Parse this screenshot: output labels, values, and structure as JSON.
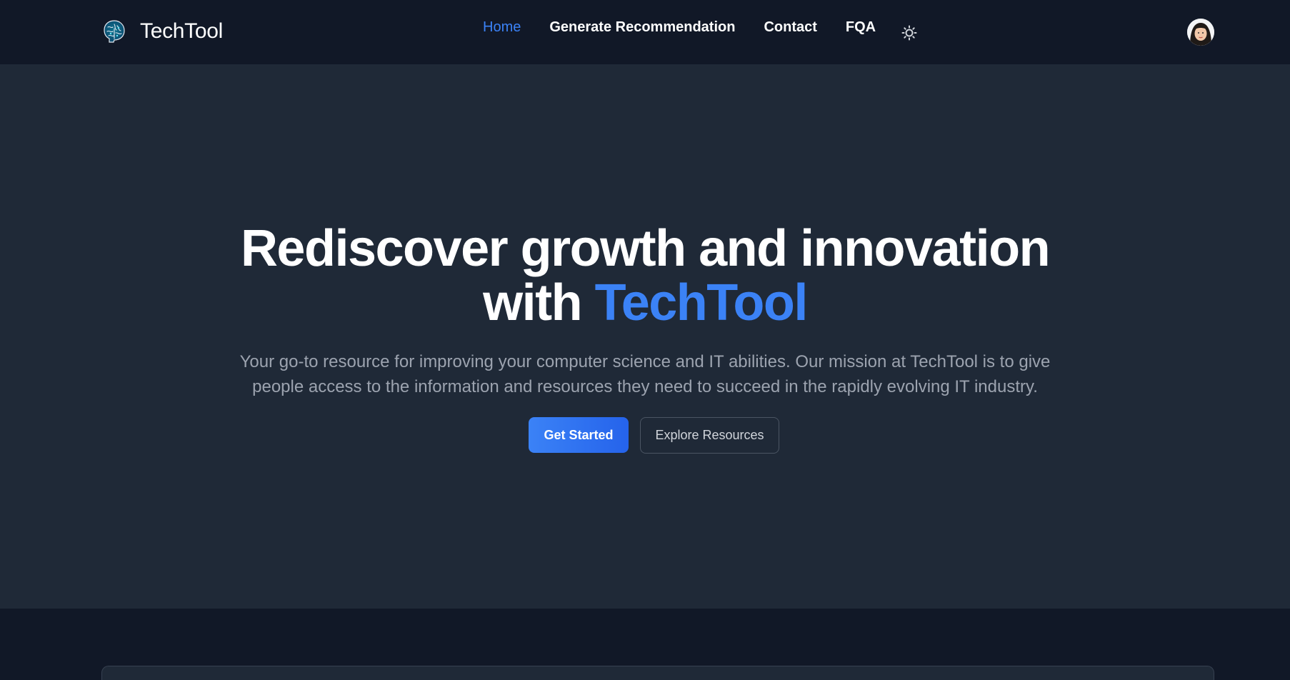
{
  "brand": {
    "name": "TechTool",
    "logo_icon": "brain-icon"
  },
  "nav": {
    "links": [
      {
        "label": "Home",
        "active": true
      },
      {
        "label": "Generate Recommendation",
        "active": false
      },
      {
        "label": "Contact",
        "active": false
      },
      {
        "label": "FQA",
        "active": false
      }
    ],
    "theme_toggle_icon": "sun-icon",
    "avatar_icon": "user-avatar"
  },
  "hero": {
    "title_line1": "Rediscover growth and innovation",
    "title_with": "with",
    "title_accent": "TechTool",
    "subtitle": "Your go-to resource for improving your computer science and IT abilities. Our mission at TechTool is to give people access to the information and resources they need to succeed in the rapidly evolving IT industry.",
    "primary_button": "Get Started",
    "secondary_button": "Explore Resources"
  },
  "colors": {
    "nav_background": "#111827",
    "hero_background": "#1f2937",
    "accent": "#3b82f6",
    "text": "#ffffff",
    "muted_text": "#9ca3af"
  }
}
